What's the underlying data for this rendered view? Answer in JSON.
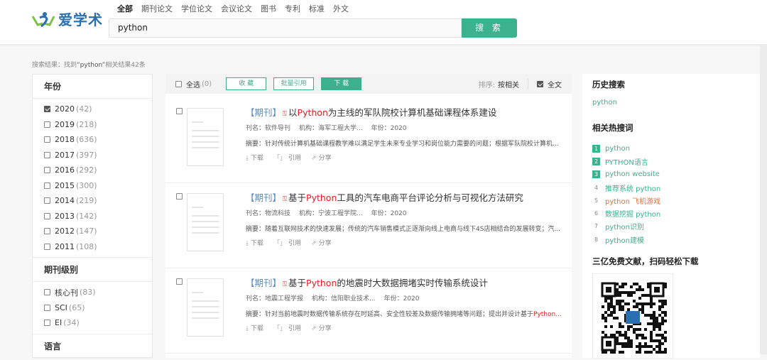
{
  "header": {
    "logo_text": "爱学术",
    "tabs": [
      "全部",
      "期刊论文",
      "学位论文",
      "会议论文",
      "图书",
      "专利",
      "标准",
      "外文"
    ],
    "search_value": "python",
    "search_button": "搜 索"
  },
  "summary": {
    "prefix": "搜索结果：找到",
    "query": "“python”",
    "suffix": "相关结果42条"
  },
  "filters": {
    "year": {
      "title": "年份",
      "items": [
        {
          "label": "2020",
          "count": "(42)",
          "checked": true
        },
        {
          "label": "2019",
          "count": "(218)"
        },
        {
          "label": "2018",
          "count": "(636)"
        },
        {
          "label": "2017",
          "count": "(397)"
        },
        {
          "label": "2016",
          "count": "(292)"
        },
        {
          "label": "2015",
          "count": "(300)"
        },
        {
          "label": "2014",
          "count": "(219)"
        },
        {
          "label": "2013",
          "count": "(142)"
        },
        {
          "label": "2012",
          "count": "(147)"
        },
        {
          "label": "2011",
          "count": "(108)"
        }
      ]
    },
    "level": {
      "title": "期刊级别",
      "items": [
        {
          "label": "核心刊",
          "count": "(83)"
        },
        {
          "label": "SCI",
          "count": "(65)"
        },
        {
          "label": "EI",
          "count": "(34)"
        }
      ]
    },
    "lang": {
      "title": "语言"
    }
  },
  "toolbar": {
    "select_all": "全选",
    "select_count": "(0)",
    "collect": "收 藏",
    "batch_cite": "批量引用",
    "download": "下 载",
    "sort_label": "排序:",
    "sort_value": "按相关",
    "fulltext": "全文"
  },
  "results": [
    {
      "type": "【期刊】",
      "pre": "以",
      "hl": "Python",
      "post": "为主线的军队院校计算机基础课程体系建设",
      "journal": "刊名：软件导刊",
      "org": "机构：海军工程大学...",
      "year": "年份：2020",
      "abstract": "摘要：针对传统计算机基础课程教学难以满足学生未来专业学习和岗位能力需要的问题；根据军队院校计算机...",
      "abstract_hl": ""
    },
    {
      "type": "【期刊】",
      "pre": "基于",
      "hl": "Python",
      "post": "工具的汽车电商平台评论分析与可视化方法研究",
      "journal": "刊名：物流科技",
      "org": "机构：宁波工程学院...",
      "year": "年份：2020",
      "abstract": "摘要：随着互联网技术的快速发展；传统的汽车销售模式正逐渐向线上电商与线下4S店相结合的发展转变；汽...",
      "abstract_hl": ""
    },
    {
      "type": "【期刊】",
      "pre": "基于",
      "hl": "Python",
      "post": "的地震时大数据拥堵实时传输系统设计",
      "journal": "刊名：地震工程学报",
      "org": "机构：信阳职业技术...",
      "year": "年份：2020",
      "abstract": "摘要：针对当前地震时数据传输系统存在时延高、安全性较差及数据传输拥堵等问题；提出并设计基于",
      "abstract_hl": "Python..."
    }
  ],
  "actions": {
    "download": "下载",
    "cite": "引用",
    "share": "分享"
  },
  "right": {
    "history_title": "历史搜索",
    "history": [
      "python"
    ],
    "hot_title": "相关热搜词",
    "hot": [
      {
        "n": "1",
        "t": "python"
      },
      {
        "n": "2",
        "t": "PYTHON语言"
      },
      {
        "n": "3",
        "t": "python website"
      },
      {
        "n": "4",
        "t": "推荐系统 python"
      },
      {
        "n": "5",
        "t": "python 飞机游戏"
      },
      {
        "n": "6",
        "t": "数据挖掘 python"
      },
      {
        "n": "7",
        "t": "python识别"
      },
      {
        "n": "8",
        "t": "python建模"
      }
    ],
    "qr_title": "三亿免费文献，扫码轻松下载"
  },
  "colors": {
    "accent": "#3cb18e",
    "highlight": "#e02020",
    "hot_red": "#e8703a"
  }
}
